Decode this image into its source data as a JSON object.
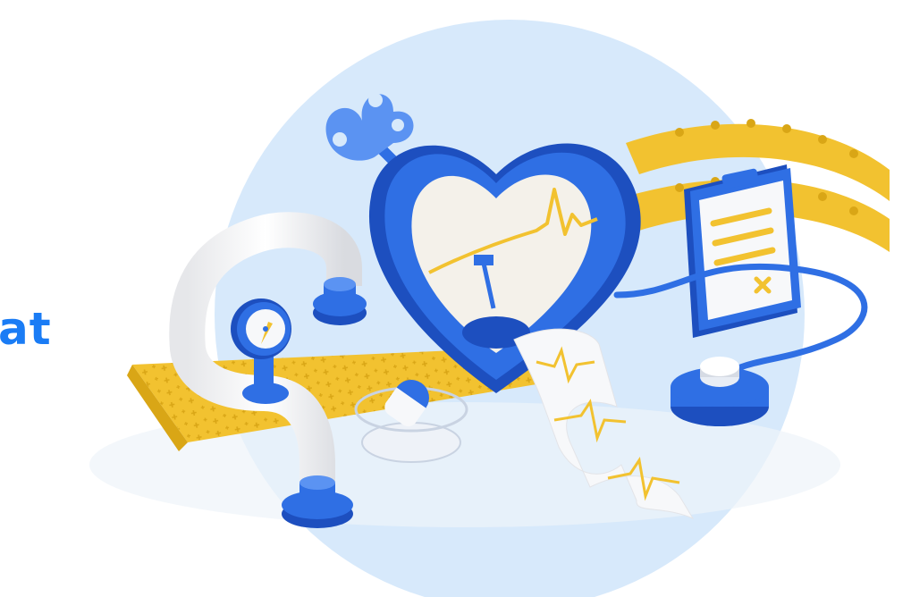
{
  "headline": {
    "visible_text": "at"
  },
  "illustration": {
    "subject": "heart-rate-monitor",
    "palette": {
      "blue": "#2f6fe4",
      "blue_dark": "#1d4fbf",
      "blue_light": "#5b93f2",
      "backdrop": "#d7e9fb",
      "yellow": "#f2c230",
      "yellow_dark": "#d9a616",
      "white": "#f7f8fa",
      "cream": "#f4f1ea"
    }
  }
}
